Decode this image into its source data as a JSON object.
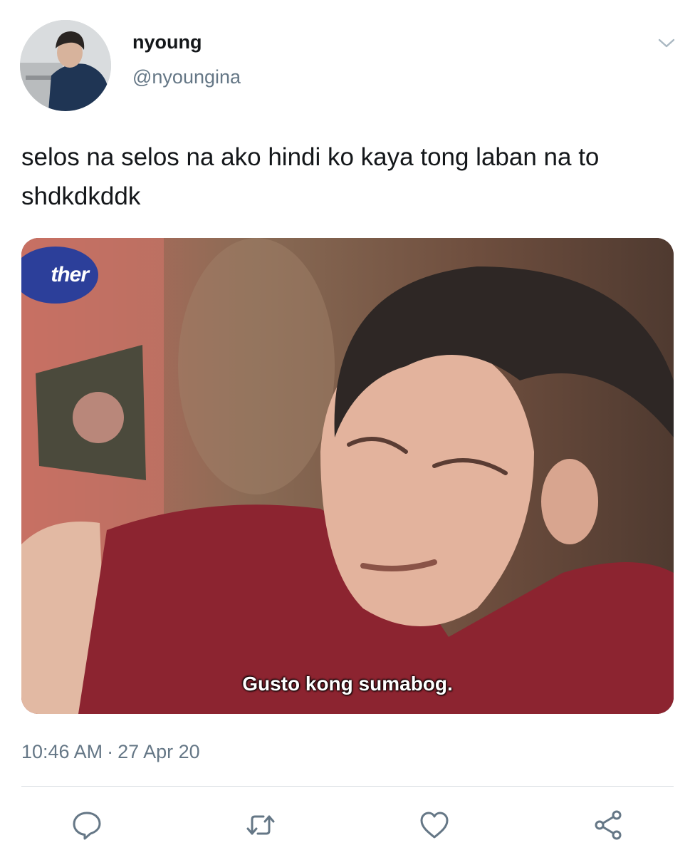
{
  "tweet": {
    "display_name": "nyoung",
    "handle": "@nyoungina",
    "text": "selos na selos na ako hindi ko kaya tong laban na to shdkdkddk",
    "time": "10:46 AM",
    "separator": "·",
    "date": "27 Apr 20"
  },
  "media": {
    "logo_text": "ther",
    "caption": "Gusto kong sumabog."
  },
  "icons": {
    "menu": "chevron-down-icon",
    "reply": "reply-icon",
    "retweet": "retweet-icon",
    "like": "heart-icon",
    "share": "share-icon"
  },
  "colors": {
    "text_primary": "#14171a",
    "text_secondary": "#657786",
    "icon": "#657786",
    "divider": "#d8dde1"
  }
}
